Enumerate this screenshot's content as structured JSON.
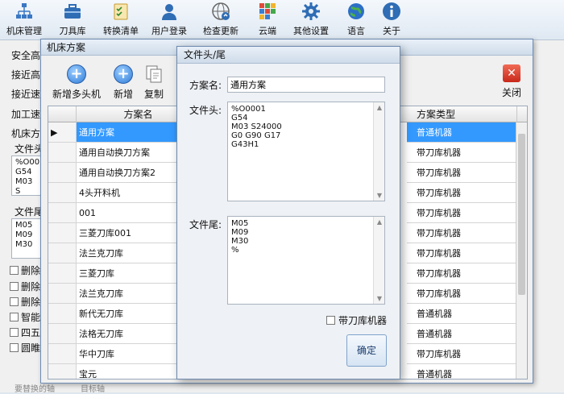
{
  "toolbar": {
    "items": [
      {
        "label": "机床管理",
        "icon": "network-icon"
      },
      {
        "label": "刀具库",
        "icon": "toolbox-icon"
      },
      {
        "label": "转换清单",
        "icon": "checklist-icon"
      },
      {
        "label": "用户登录",
        "icon": "user-icon"
      },
      {
        "label": "检查更新",
        "icon": "globe-update-icon"
      },
      {
        "label": "云端",
        "icon": "cloud-grid-icon"
      },
      {
        "label": "其他设置",
        "icon": "gear-icon"
      },
      {
        "label": "语言",
        "icon": "globe-icon"
      },
      {
        "label": "关于",
        "icon": "info-icon"
      }
    ]
  },
  "background": {
    "labels": [
      "安全高",
      "接近高",
      "接近速",
      "加工速",
      "机床方"
    ],
    "file_head_label": "文件头",
    "file_head_lines": [
      "%O00",
      "G54",
      "M03 S"
    ],
    "file_tail_label": "文件尾",
    "file_tail_lines": [
      "M05",
      "M09",
      "M30"
    ],
    "checks": [
      "删除",
      "删除",
      "删除",
      "智能",
      "四五",
      "圆睢"
    ],
    "bottom_left": "要替换的轴",
    "bottom_right": "目标轴"
  },
  "machine_window": {
    "title": "机床方案",
    "tools": {
      "add_multi": "新增多头机",
      "add": "新增",
      "copy": "复制",
      "close": "关闭"
    },
    "columns": [
      "方案名",
      "方案类型"
    ],
    "rows": [
      {
        "name": "通用方案",
        "type": "普通机器",
        "selected": true
      },
      {
        "name": "通用自动换刀方案",
        "type": "带刀库机器"
      },
      {
        "name": "通用自动换刀方案2",
        "type": "带刀库机器"
      },
      {
        "name": "4头开料机",
        "type": "带刀库机器"
      },
      {
        "name": "001",
        "type": "带刀库机器"
      },
      {
        "name": "三菱刀库001",
        "type": "带刀库机器"
      },
      {
        "name": "法兰克刀库",
        "type": "带刀库机器"
      },
      {
        "name": "三菱刀库",
        "type": "带刀库机器"
      },
      {
        "name": "法兰克刀库",
        "type": "带刀库机器"
      },
      {
        "name": "新代无刀库",
        "type": "普通机器"
      },
      {
        "name": "法格无刀库",
        "type": "普通机器"
      },
      {
        "name": "华中刀库",
        "type": "带刀库机器"
      },
      {
        "name": "宝元",
        "type": "普通机器"
      }
    ]
  },
  "dialog": {
    "title": "文件头/尾",
    "scheme_label": "方案名:",
    "scheme_value": "通用方案",
    "head_label": "文件头:",
    "head_lines": [
      "%O0001",
      "G54",
      "M03 S24000",
      "G0 G90 G17",
      "G43H1"
    ],
    "tail_label": "文件尾:",
    "tail_lines": [
      "M05",
      "M09",
      "M30",
      "%"
    ],
    "checkbox_label": "带刀库机器",
    "checkbox_checked": false,
    "ok_label": "确定"
  }
}
